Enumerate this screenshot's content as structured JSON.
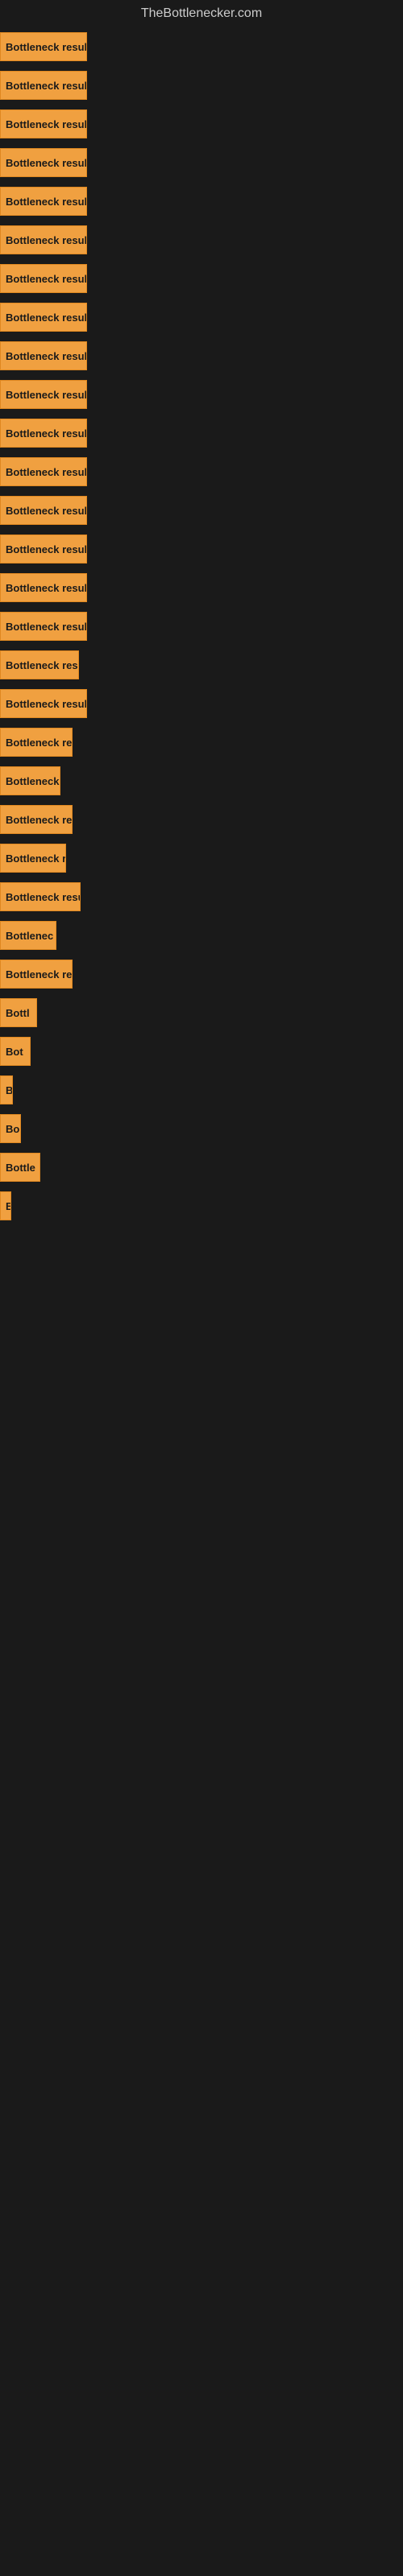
{
  "site": {
    "title": "TheBottlenecker.com"
  },
  "bars": [
    {
      "label": "Bottleneck result",
      "width": 108
    },
    {
      "label": "Bottleneck result",
      "width": 108
    },
    {
      "label": "Bottleneck result",
      "width": 108
    },
    {
      "label": "Bottleneck result",
      "width": 108
    },
    {
      "label": "Bottleneck result",
      "width": 108
    },
    {
      "label": "Bottleneck result",
      "width": 108
    },
    {
      "label": "Bottleneck result",
      "width": 108
    },
    {
      "label": "Bottleneck result",
      "width": 108
    },
    {
      "label": "Bottleneck result",
      "width": 108
    },
    {
      "label": "Bottleneck result",
      "width": 108
    },
    {
      "label": "Bottleneck result",
      "width": 108
    },
    {
      "label": "Bottleneck result",
      "width": 108
    },
    {
      "label": "Bottleneck result",
      "width": 108
    },
    {
      "label": "Bottleneck result",
      "width": 108
    },
    {
      "label": "Bottleneck result",
      "width": 108
    },
    {
      "label": "Bottleneck result",
      "width": 108
    },
    {
      "label": "Bottleneck res",
      "width": 98
    },
    {
      "label": "Bottleneck result",
      "width": 108
    },
    {
      "label": "Bottleneck re",
      "width": 90
    },
    {
      "label": "Bottleneck",
      "width": 75
    },
    {
      "label": "Bottleneck re",
      "width": 90
    },
    {
      "label": "Bottleneck r",
      "width": 82
    },
    {
      "label": "Bottleneck resu",
      "width": 100
    },
    {
      "label": "Bottlenec",
      "width": 70
    },
    {
      "label": "Bottleneck re",
      "width": 90
    },
    {
      "label": "Bottl",
      "width": 46
    },
    {
      "label": "Bot",
      "width": 38
    },
    {
      "label": "B",
      "width": 16
    },
    {
      "label": "Bo",
      "width": 26
    },
    {
      "label": "Bottle",
      "width": 50
    },
    {
      "label": "B",
      "width": 14
    }
  ],
  "colors": {
    "bar_bg": "#f0a040",
    "bar_border": "#e08820",
    "bar_text": "#1a1a1a",
    "page_bg": "#1a1a1a",
    "title_text": "#cccccc"
  }
}
